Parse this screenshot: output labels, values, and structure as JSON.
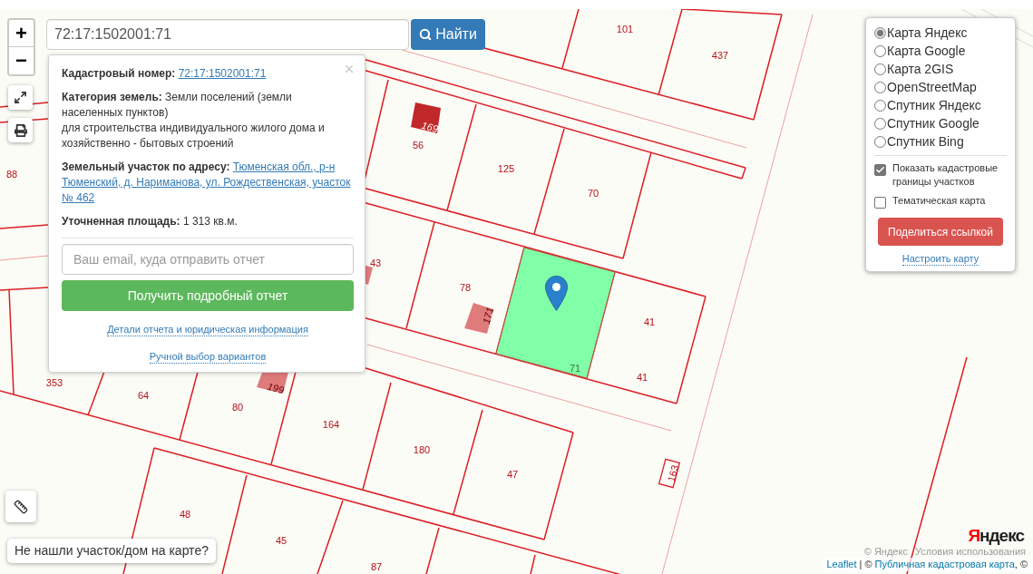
{
  "search": {
    "value": "72:17:1502001:71",
    "button": "Найти"
  },
  "zoom": {
    "in": "+",
    "out": "−"
  },
  "popup": {
    "cadastral_number": {
      "label": "Кадастровый номер:",
      "link": "72:17:1502001:71"
    },
    "land_category": "**Категория земель:** Земли поселений (земли населенных пунктов)\nдля строительства индивидуального жилого дома и хозяйственно - бытовых строений",
    "address": {
      "label": "Земельный участок по адресу:",
      "link": "Тюменская обл., р-н Тюменский, д. Нариманова, ул. Рождественская, участок № 462"
    },
    "area": "**Уточненная площадь:** 1 313 кв.м.",
    "email": {
      "placeholder": "Ваш email, куда отправить отчет"
    },
    "report_button": "Получить подробный отчет",
    "links": [
      "Детали отчета и юридическая информация",
      "Ручной выбор вариантов"
    ]
  },
  "layers": {
    "base_maps": [
      {
        "label": "Карта Яндекс",
        "selected": true
      },
      {
        "label": "Карта Google",
        "selected": false
      },
      {
        "label": "Карта 2GIS",
        "selected": false
      },
      {
        "label": "OpenStreetMap",
        "selected": false
      },
      {
        "label": "Спутник Яндекс",
        "selected": false
      },
      {
        "label": "Спутник Google",
        "selected": false
      },
      {
        "label": "Спутник Bing",
        "selected": false
      }
    ],
    "overlays": [
      {
        "label": "Показать кадастровые границы участков",
        "checked": true
      },
      {
        "label": "Тематическая карта",
        "checked": false
      }
    ],
    "share_button": "Поделиться ссылкой",
    "settings_link": "Настроить карту"
  },
  "parcels": [
    {
      "number": "101",
      "kind": "parcel"
    },
    {
      "number": "437",
      "kind": "parcel"
    },
    {
      "number": "169",
      "kind": "building",
      "color": "#c0282a"
    },
    {
      "number": "56",
      "kind": "parcel"
    },
    {
      "number": "125",
      "kind": "parcel"
    },
    {
      "number": "88",
      "kind": "parcel"
    },
    {
      "number": "70",
      "kind": "parcel"
    },
    {
      "number": "43",
      "kind": "parcel"
    },
    {
      "number": "78",
      "kind": "parcel"
    },
    {
      "number": "171",
      "kind": "building",
      "color": "#e07b7b"
    },
    {
      "number": "41",
      "kind": "parcel"
    },
    {
      "number": "71",
      "kind": "selected"
    },
    {
      "number": "41",
      "kind": "parcel"
    },
    {
      "number": "199",
      "kind": "building",
      "color": "#e07b7b"
    },
    {
      "number": "353",
      "kind": "parcel"
    },
    {
      "number": "64",
      "kind": "parcel"
    },
    {
      "number": "80",
      "kind": "parcel"
    },
    {
      "number": "164",
      "kind": "parcel"
    },
    {
      "number": "180",
      "kind": "parcel"
    },
    {
      "number": "47",
      "kind": "parcel"
    },
    {
      "number": "163",
      "kind": "structure"
    },
    {
      "number": "48",
      "kind": "parcel"
    },
    {
      "number": "45",
      "kind": "parcel"
    },
    {
      "number": "87",
      "kind": "parcel"
    }
  ],
  "help_button": "Не нашли участок/дом на карте?",
  "logo": "Яндекс",
  "map_notice": [
    "© Яндекс",
    "Условия использования"
  ],
  "attribution": {
    "leaflet_link": "Leaflet",
    "separator": "| ©",
    "source_link": "Публичная кадастровая карта",
    "trailing": ", ©"
  }
}
